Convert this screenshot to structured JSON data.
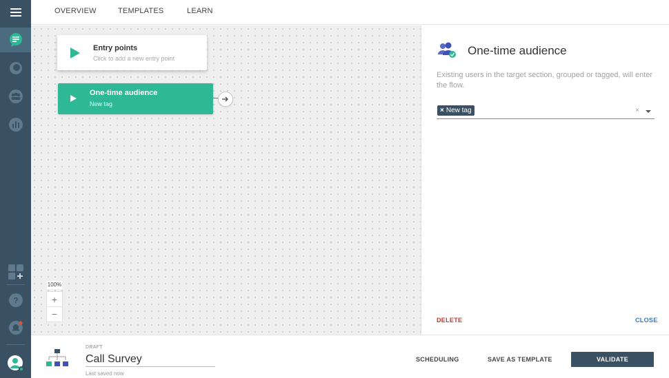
{
  "nav": {
    "tabs": [
      "OVERVIEW",
      "TEMPLATES",
      "LEARN"
    ]
  },
  "sidebar": {
    "icons": [
      "menu-icon",
      "chat-flow-icon",
      "conversations-icon",
      "audience-icon",
      "analytics-icon",
      "add-apps-icon",
      "help-icon",
      "notifications-icon",
      "profile-icon"
    ]
  },
  "canvas": {
    "entry_node": {
      "title": "Entry points",
      "subtitle": "Click to add a new entry point"
    },
    "audience_node": {
      "title": "One-time audience",
      "subtitle": "New tag"
    },
    "zoom_level": "100%",
    "zoom_in": "+",
    "zoom_out": "−"
  },
  "panel": {
    "title": "One-time audience",
    "description": "Existing users in the target section, grouped or tagged, will enter the flow.",
    "selected_tag": "New tag",
    "delete_label": "DELETE",
    "close_label": "CLOSE"
  },
  "footer": {
    "status": "DRAFT",
    "flow_name": "Call Survey",
    "saved_status": "Last saved now",
    "scheduling_label": "SCHEDULING",
    "save_template_label": "SAVE AS TEMPLATE",
    "validate_label": "VALIDATE"
  },
  "colors": {
    "sidebar": "#3a5163",
    "accent_green": "#2fb896",
    "delete_red": "#c0392b",
    "close_blue": "#3a7bbf"
  }
}
